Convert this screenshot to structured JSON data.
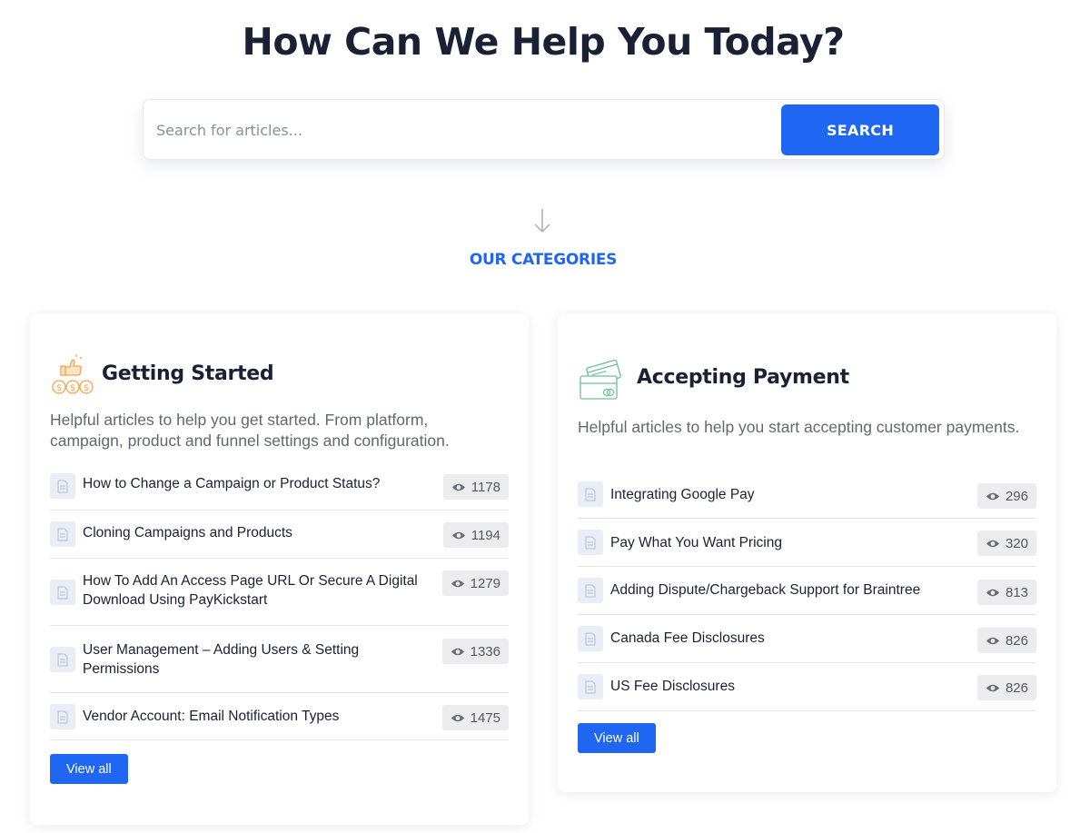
{
  "hero": {
    "title": "How Can We Help You Today?"
  },
  "search": {
    "placeholder": "Search for articles...",
    "button_label": "SEARCH"
  },
  "categories_heading": "OUR CATEGORIES",
  "icons": {
    "arrow": "arrow-down-icon",
    "eye": "eye-icon",
    "doc": "document-icon"
  },
  "colors": {
    "accent": "#1f66f2",
    "heading": "#1b2135",
    "muted": "#65676d"
  },
  "cards": [
    {
      "title": "Getting Started",
      "icon": "thumbs-up-coins-icon",
      "description": "Helpful articles to help you get started. From platform, campaign, product and funnel settings and configuration.",
      "articles": [
        {
          "title": "How to Change a Campaign or Product Status?",
          "views": "1178"
        },
        {
          "title": "Cloning Campaigns and Products",
          "views": "1194"
        },
        {
          "title": "How To Add An Access Page URL Or Secure A Digital Download Using PayKickstart",
          "views": "1279"
        },
        {
          "title": "User Management – Adding Users & Setting Permissions",
          "views": "1336"
        },
        {
          "title": "Vendor Account: Email Notification Types",
          "views": "1475"
        }
      ],
      "view_all_label": "View all"
    },
    {
      "title": "Accepting Payment",
      "icon": "credit-cards-icon",
      "description": "Helpful articles to help you start accepting customer payments.",
      "articles": [
        {
          "title": "Integrating Google Pay",
          "views": "296"
        },
        {
          "title": "Pay What You Want Pricing",
          "views": "320"
        },
        {
          "title": "Adding Dispute/Chargeback Support for Braintree",
          "views": "813"
        },
        {
          "title": "Canada Fee Disclosures",
          "views": "826"
        },
        {
          "title": "US Fee Disclosures",
          "views": "826"
        }
      ],
      "view_all_label": "View all"
    }
  ]
}
